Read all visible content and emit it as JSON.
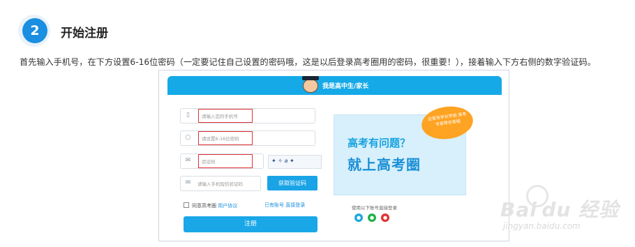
{
  "step": {
    "number": "2",
    "title": "开始注册"
  },
  "instruction": "首先输入手机号，在下方设置6-16位密码（一定要记住自己设置的密码哦，这是以后登录高考圈用的密码，很重要！），接着输入下方右侧的数字验证码。",
  "form": {
    "header_title": "我是高中生/家长",
    "phone_placeholder": "请输入您的手机号",
    "password_placeholder": "请设置6-16位密码",
    "captcha_placeholder": "验证码",
    "captcha_image_text": "✦ ✧ a ✦",
    "sms_placeholder": "请输入手机短信验证码",
    "sms_button": "获取验证码",
    "agree_text": "同意高考圈",
    "agree_link": "用户协议",
    "has_account": "已有账号 直接登录",
    "register_button": "注册",
    "social_label": "使用以下账号直接登录"
  },
  "promo": {
    "bubble_text": "这里有学长学姐 高考专家帮你答疑",
    "question": "高考有问题？",
    "main": "就上高考圈"
  },
  "watermark": {
    "text": "Bai du 经验",
    "url": "jingyan.baidu.com"
  },
  "colors": {
    "accent": "#1a8ee0",
    "header": "#16a9e7",
    "highlight": "#e23232",
    "bubble": "#ffa322"
  },
  "icons": {
    "phone": "phone-icon",
    "lock": "lock-icon",
    "mail": "mail-icon",
    "qq": "qq-icon",
    "wechat": "wechat-icon",
    "weibo": "weibo-icon"
  }
}
